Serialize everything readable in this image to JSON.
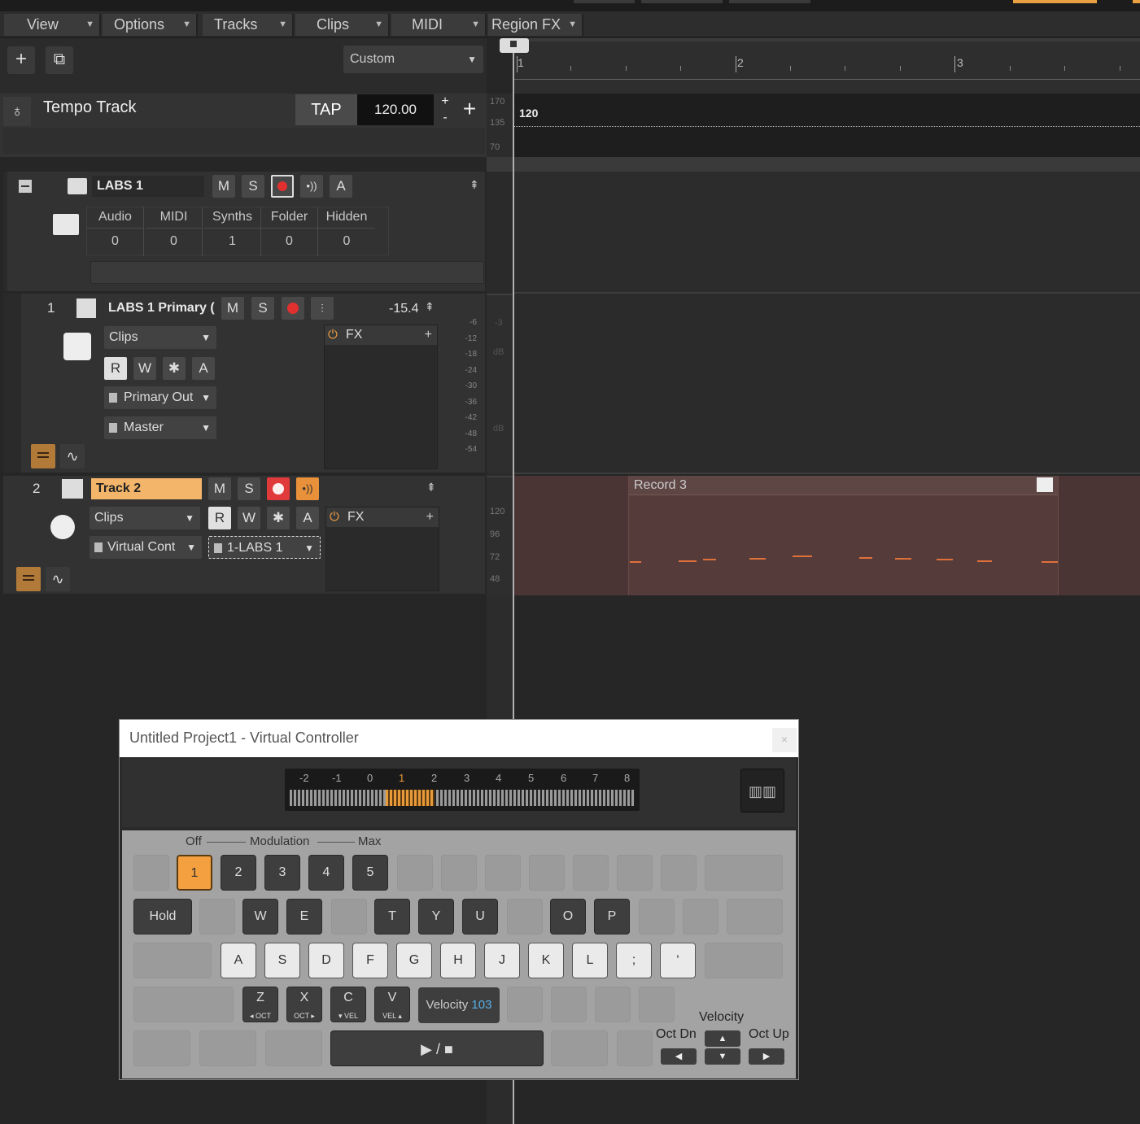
{
  "menubar": {
    "items": [
      "View",
      "Options",
      "Tracks",
      "Clips",
      "MIDI",
      "Region FX"
    ]
  },
  "toolbar": {
    "view_preset": "Custom",
    "add_icon": "plus-icon",
    "duplicate_icon": "duplicate-icon"
  },
  "ruler": {
    "bars": [
      "1",
      "2",
      "3"
    ]
  },
  "tempo_track": {
    "name": "Tempo Track",
    "tap_label": "TAP",
    "tempo": "120.00",
    "plus": "+",
    "minus": "-",
    "add": "+",
    "scale": [
      "170",
      "135",
      "70"
    ],
    "lane_value": "120"
  },
  "folder": {
    "name": "LABS 1",
    "mute": "M",
    "solo": "S",
    "auto": "A",
    "stats_headers": [
      "Audio",
      "MIDI",
      "Synths",
      "Folder",
      "Hidden"
    ],
    "stats_values": [
      "0",
      "0",
      "1",
      "0",
      "0"
    ]
  },
  "track1": {
    "number": "1",
    "name": "LABS 1 Primary (",
    "mute": "M",
    "solo": "S",
    "level": "-15.4",
    "clips_label": "Clips",
    "read": "R",
    "write": "W",
    "star": "✱",
    "auto": "A",
    "output": "Primary Out",
    "send": "Master",
    "fx_label": "FX",
    "meter_scale": [
      "-6",
      "-12",
      "-18",
      "-24",
      "-30",
      "-36",
      "-42",
      "-48",
      "-54"
    ],
    "db_labels": [
      "dB",
      "dB"
    ]
  },
  "track2": {
    "number": "2",
    "name": "Track 2",
    "mute": "M",
    "solo": "S",
    "clips_label": "Clips",
    "read": "R",
    "write": "W",
    "star": "✱",
    "auto": "A",
    "input": "Virtual Cont",
    "output": "1-LABS 1",
    "fx_label": "FX",
    "lane_scale": [
      "120",
      "96",
      "72",
      "48"
    ]
  },
  "clip": {
    "name": "Record 3"
  },
  "virtual_controller": {
    "title": "Untitled Project1 - Virtual Controller",
    "close": "×",
    "octaves": [
      "-2",
      "-1",
      "0",
      "1",
      "2",
      "3",
      "4",
      "5",
      "6",
      "7",
      "8"
    ],
    "modulation_labels": {
      "off": "Off",
      "mid": "Modulation",
      "max": "Max"
    },
    "mod_keys": [
      "1",
      "2",
      "3",
      "4",
      "5"
    ],
    "hold_label": "Hold",
    "row_qwerty": [
      "W",
      "E",
      "T",
      "Y",
      "U",
      "O",
      "P"
    ],
    "row_home": [
      "A",
      "S",
      "D",
      "F",
      "G",
      "H",
      "J",
      "K",
      "L",
      ";",
      "‘"
    ],
    "row_bottom": [
      {
        "key": "Z",
        "sub": "◂ OCT"
      },
      {
        "key": "X",
        "sub": "OCT ▸"
      },
      {
        "key": "C",
        "sub": "▾ VEL"
      },
      {
        "key": "V",
        "sub": "VEL ▴"
      }
    ],
    "velocity_label": "Velocity",
    "velocity_value": "103",
    "play_stop": "▶ / ■",
    "oct_dn": "Oct Dn",
    "oct_up": "Oct Up",
    "velocity_caption": "Velocity"
  }
}
